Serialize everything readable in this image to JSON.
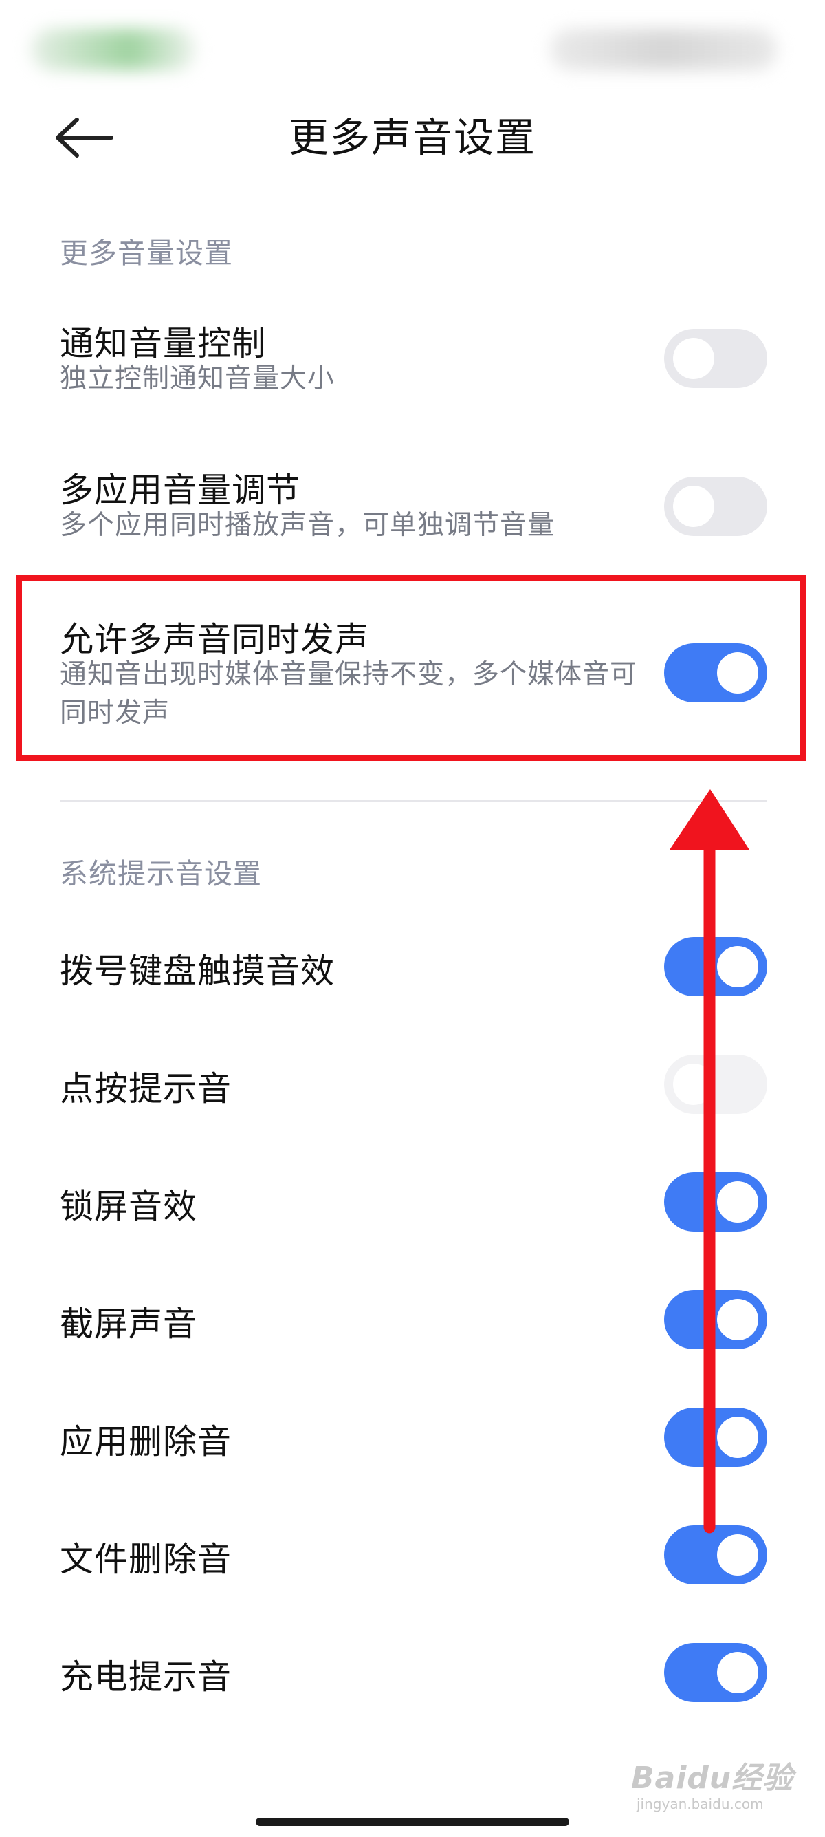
{
  "header": {
    "title": "更多声音设置",
    "back_icon": "arrow-left-icon"
  },
  "volume_section": {
    "header": "更多音量设置",
    "items": [
      {
        "title": "通知音量控制",
        "subtitle": "独立控制通知音量大小",
        "enabled": false
      },
      {
        "title": "多应用音量调节",
        "subtitle": "多个应用同时播放声音，可单独调节音量",
        "enabled": false
      },
      {
        "title": "允许多声音同时发声",
        "subtitle": "通知音出现时媒体音量保持不变，多个媒体音可同时发声",
        "enabled": true
      }
    ]
  },
  "system_section": {
    "header": "系统提示音设置",
    "items": [
      {
        "title": "拨号键盘触摸音效",
        "enabled": true
      },
      {
        "title": "点按提示音",
        "enabled": false
      },
      {
        "title": "锁屏音效",
        "enabled": true
      },
      {
        "title": "截屏声音",
        "enabled": true
      },
      {
        "title": "应用删除音",
        "enabled": true
      },
      {
        "title": "文件删除音",
        "enabled": true
      },
      {
        "title": "充电提示音",
        "enabled": true
      }
    ]
  },
  "annotation": {
    "highlight_color": "#f0141e",
    "arrow_color": "#f0141e",
    "arrow_direction": "up"
  },
  "watermark": {
    "brand": "Baidu经验",
    "domain": "jingyan.baidu.com"
  },
  "colors": {
    "toggle_on": "#3f7bf5",
    "toggle_off": "#e8e8ec",
    "section_header": "#8a8fa0"
  }
}
